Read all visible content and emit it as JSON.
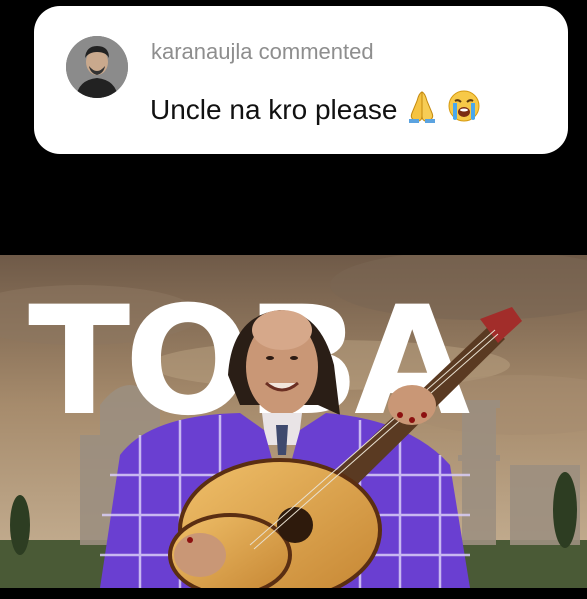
{
  "comment": {
    "username": "karanaujla",
    "action": "commented",
    "text": "Uncle na kro please",
    "emojis": [
      "folded-hands",
      "loudly-crying-face"
    ]
  },
  "video": {
    "title_overlay": "TOBA"
  },
  "colors": {
    "card_bg": "#ffffff",
    "username": "#8e8e8e",
    "comment_text": "#111111",
    "background": "#000000",
    "suit": "#6a3fd1",
    "guitar": "#d9a24b"
  }
}
